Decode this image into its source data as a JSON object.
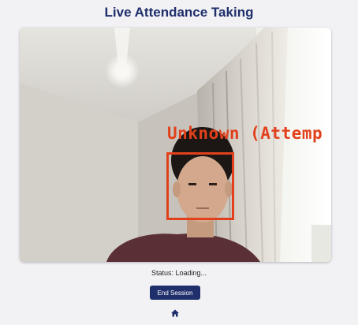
{
  "header": {
    "title": "Live Attendance Taking"
  },
  "camera": {
    "detection_label": "Unknown (Attemp"
  },
  "status": {
    "text": "Status: Loading..."
  },
  "actions": {
    "end_session_label": "End Session",
    "home_icon": "home-icon"
  },
  "colors": {
    "primary": "#1f2f6b",
    "detection": "#e2401c",
    "background": "#f2f2f5"
  }
}
